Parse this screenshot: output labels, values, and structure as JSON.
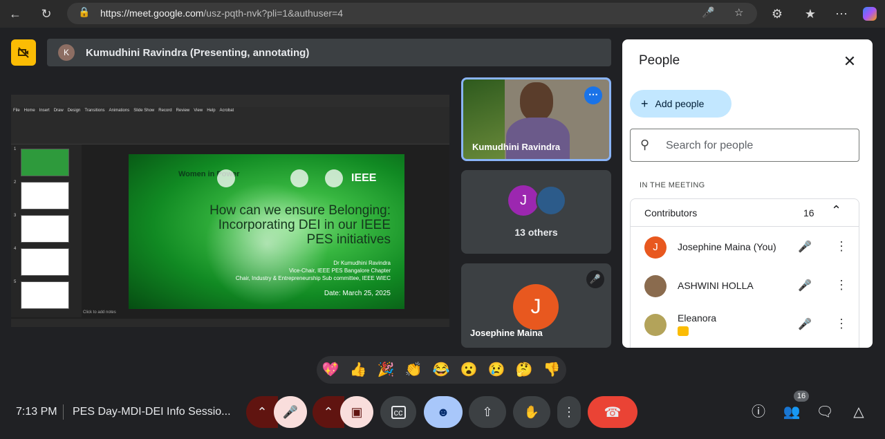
{
  "browser": {
    "url_host": "https://meet.google.com",
    "url_path": "/usz-pqth-nvk?pli=1&authuser=4",
    "icons": [
      "back-arrow-icon",
      "reload-icon",
      "lock-icon",
      "microphone-icon",
      "star-icon",
      "extensions-icon",
      "favorites-icon",
      "more-icon",
      "copilot-icon"
    ]
  },
  "presenting_bar": {
    "avatar_letter": "K",
    "text": "Kumudhini Ravindra (Presenting, annotating)"
  },
  "slide": {
    "logo_text": "Women in Power",
    "logo_right": "IEEE",
    "title": "How can we ensure Belonging:\nIncorporating DEI in our IEEE\nPES initiatives",
    "subtitle_lines": [
      "Dr Kumudhini Ravindra",
      "Vice-Chair, IEEE PES Bangalore Chapter",
      "Chair, Industry & Entrepreneurship Sub committee, IEEE WIEC"
    ],
    "date": "Date: March 25, 2025",
    "notes_hint": "Click to add notes"
  },
  "tiles": {
    "t1_name": "Kumudhini Ravindra",
    "t2_avatar_letter": "J",
    "t2_label": "13 others",
    "t3_avatar_letter": "J",
    "t3_name": "Josephine Maina"
  },
  "people_panel": {
    "title": "People",
    "add_people": "Add people",
    "search_placeholder": "Search for people",
    "section": "IN THE MEETING",
    "group_label": "Contributors",
    "group_count": "16",
    "participants": [
      {
        "name": "Josephine Maina (You)",
        "avatar": "J"
      },
      {
        "name": "ASHWINI HOLLA",
        "avatar": ""
      },
      {
        "name": "Eleanora",
        "avatar": ""
      }
    ]
  },
  "reactions": [
    "💖",
    "👍",
    "🎉",
    "👏",
    "😂",
    "😮",
    "😢",
    "🤔",
    "👎"
  ],
  "bottom": {
    "time": "7:13 PM",
    "meeting_title": "PES Day-MDI-DEI Info Sessio...",
    "people_count": "16"
  },
  "colors": {
    "accent": "#8ab4f8",
    "end_call": "#ea4335",
    "camera_alert": "#fbbc04"
  }
}
